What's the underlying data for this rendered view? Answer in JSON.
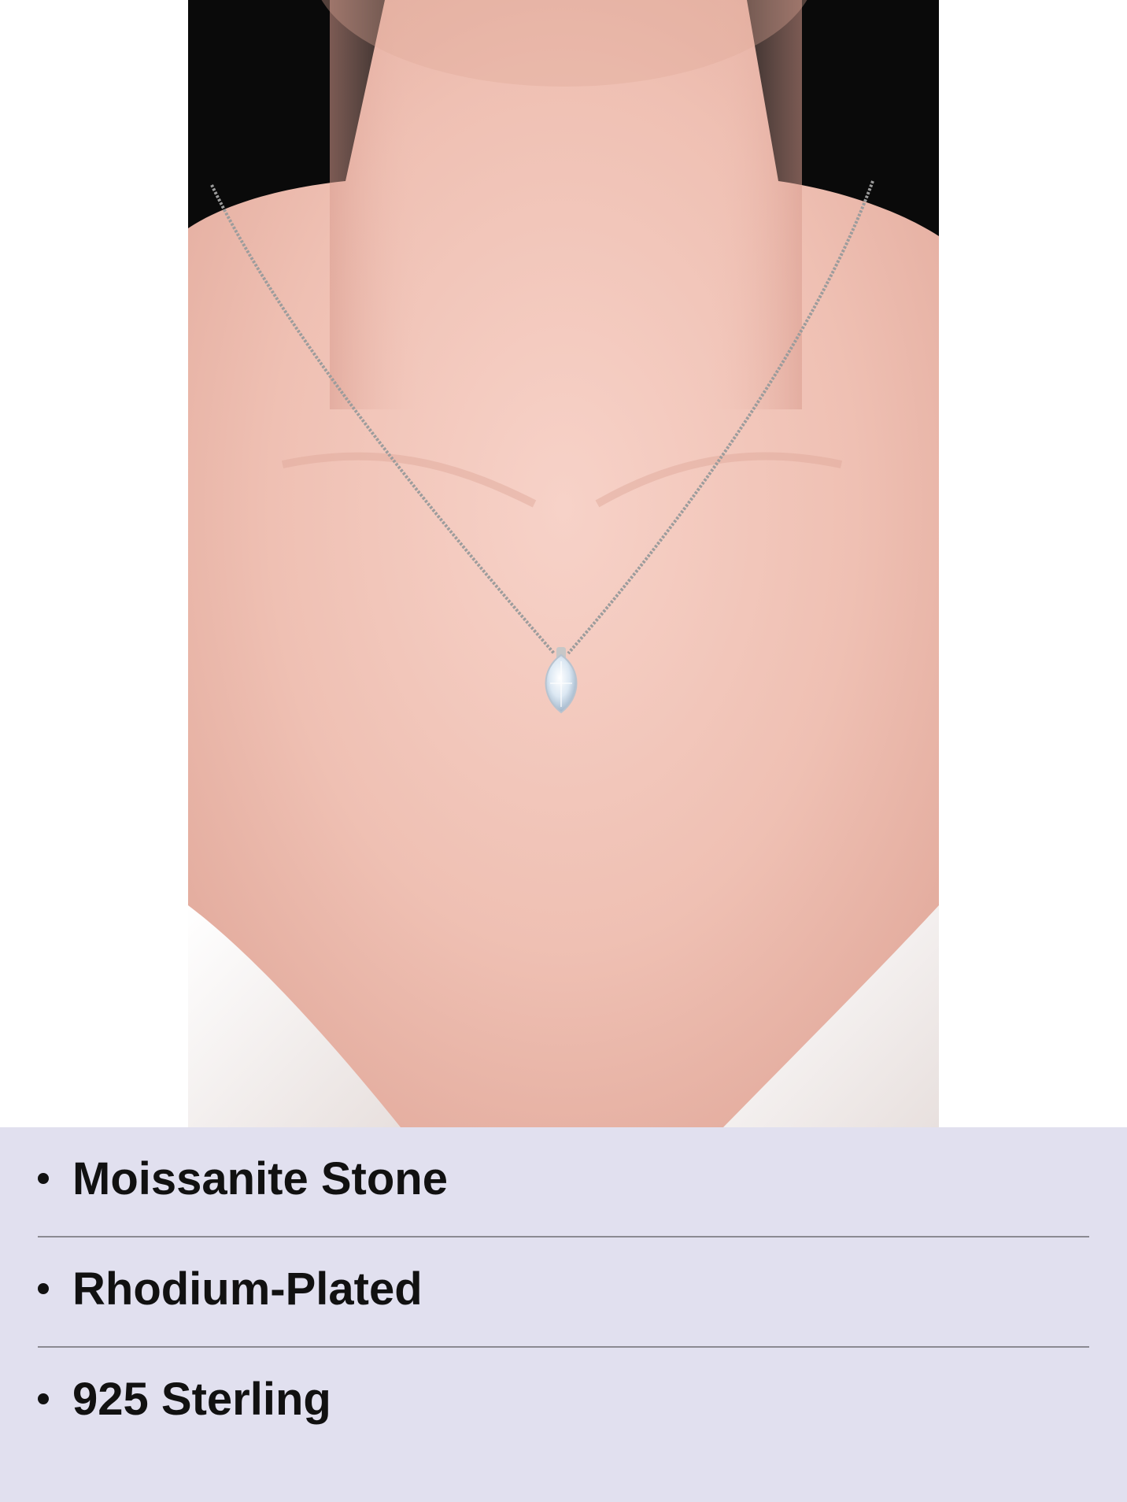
{
  "product_image": {
    "subject": "necklace-on-model",
    "colors": {
      "background": "#0a0a0a",
      "skin": "#f0c4b8",
      "chain": "#9c9c9c",
      "stone": "#d9e6f2",
      "garment": "#f4efee"
    }
  },
  "features": {
    "background": "#e1e0ef",
    "items": [
      {
        "label": "Moissanite Stone"
      },
      {
        "label": "Rhodium-Plated"
      },
      {
        "label": "925 Sterling"
      }
    ]
  }
}
